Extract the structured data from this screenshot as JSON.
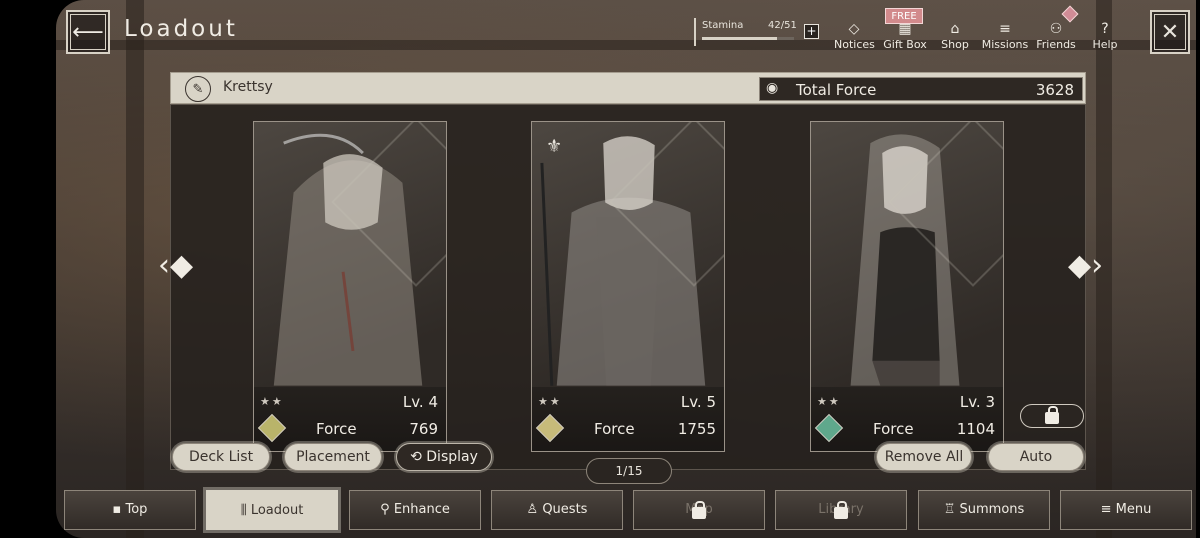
{
  "header": {
    "title": "Loadout",
    "stamina": {
      "label": "Stamina",
      "value": "42/51",
      "fraction": 0.82,
      "plus": "+"
    },
    "nav": [
      {
        "name": "notices",
        "label": "Notices",
        "icon": "◇"
      },
      {
        "name": "gift-box",
        "label": "Gift Box",
        "icon": "▦",
        "badge": "FREE"
      },
      {
        "name": "shop",
        "label": "Shop",
        "icon": "⌂"
      },
      {
        "name": "missions",
        "label": "Missions",
        "icon": "≡"
      },
      {
        "name": "friends",
        "label": "Friends",
        "icon": "⚇"
      },
      {
        "name": "help",
        "label": "Help",
        "icon": "?"
      }
    ]
  },
  "deck": {
    "name": "Krettsy",
    "total_force_label": "Total Force",
    "total_force": "3628"
  },
  "cards": [
    {
      "stars": "★★",
      "level": "Lv. 4",
      "force_label": "Force",
      "force": "769",
      "element_color": "#b9b46a"
    },
    {
      "stars": "★★",
      "level": "Lv. 5",
      "force_label": "Force",
      "force": "1755",
      "element_color": "#c7bb7a"
    },
    {
      "stars": "★★",
      "level": "Lv. 3",
      "force_label": "Force",
      "force": "1104",
      "element_color": "#5fa88c"
    }
  ],
  "actions": {
    "deck_list": "Deck List",
    "placement": "Placement",
    "display": "⟲ Display",
    "remove_all": "Remove All",
    "auto": "Auto"
  },
  "pager": "1/15",
  "bottom_nav": [
    {
      "label": "Top",
      "icon": "▪",
      "active": false,
      "locked": false
    },
    {
      "label": "Loadout",
      "icon": "⫼",
      "active": true,
      "locked": false
    },
    {
      "label": "Enhance",
      "icon": "⚲",
      "active": false,
      "locked": false
    },
    {
      "label": "Quests",
      "icon": "♙",
      "active": false,
      "locked": false
    },
    {
      "label": "Map",
      "icon": "",
      "active": false,
      "locked": true
    },
    {
      "label": "Library",
      "icon": "",
      "active": false,
      "locked": true
    },
    {
      "label": "Summons",
      "icon": "♖",
      "active": false,
      "locked": false
    },
    {
      "label": "Menu",
      "icon": "≡",
      "active": false,
      "locked": false
    }
  ]
}
